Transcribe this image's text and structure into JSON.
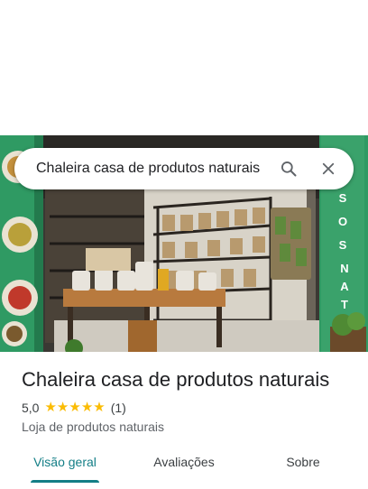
{
  "search": {
    "query": "Chaleira casa de produtos naturais"
  },
  "place": {
    "name": "Chaleira casa de produtos naturais",
    "rating": "5,0",
    "review_count": "(1)",
    "stars": 5,
    "category": "Loja de produtos naturais"
  },
  "photo": {
    "sign_text": "OS NATUR"
  },
  "tabs": [
    {
      "label": "Visão geral",
      "active": true
    },
    {
      "label": "Avaliações",
      "active": false
    },
    {
      "label": "Sobre",
      "active": false
    }
  ],
  "colors": {
    "accent": "#137e86",
    "star": "#fbbc04",
    "text": "#202124"
  }
}
